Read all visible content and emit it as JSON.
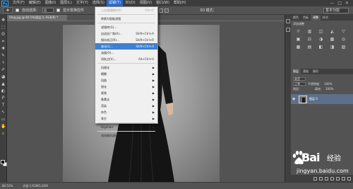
{
  "menubar": {
    "logo": "Ps",
    "items": [
      "文件(F)",
      "编辑(E)",
      "图像(I)",
      "图层(L)",
      "文字(Y)",
      "选择(S)",
      "滤镜(T)",
      "3D(D)",
      "视图(V)",
      "窗口(W)",
      "帮助(H)"
    ],
    "active_index": 6,
    "window_controls": [
      "—",
      "□",
      "✕"
    ]
  },
  "options": {
    "tool_glyph": "✥",
    "auto_select_label": "自动选择：",
    "auto_select_value": "组",
    "show_transform_label": "显示变换控件",
    "mode_3d_label": "3D 模式：",
    "workspace": "基本功能"
  },
  "document_tab": {
    "title": "timg.jpg @ 80.5%(图层 0, RGB/8) *"
  },
  "toolbox": {
    "tools": [
      "✥",
      "⬚",
      "ʘ",
      "⌗",
      "✚",
      "✎",
      "⚕",
      "✐",
      "◕",
      "▲",
      "◐",
      "P",
      "T",
      "↖",
      "▭",
      "✋",
      "⌕"
    ]
  },
  "filter_menu": {
    "groups": [
      [
        {
          "label": "上次滤镜操作(F)",
          "shortcut": "Ctrl+F",
          "disabled": true
        }
      ],
      [
        {
          "label": "转换为智能滤镜"
        }
      ],
      [
        {
          "label": "滤镜库(G)..."
        },
        {
          "label": "自适应广角(A)...",
          "shortcut": "Shift+Ctrl+A"
        },
        {
          "label": "镜头校正(R)...",
          "shortcut": "Shift+Ctrl+R"
        },
        {
          "label": "液化(L)...",
          "shortcut": "Shift+Ctrl+X",
          "highlight": true
        },
        {
          "label": "油画(O)..."
        },
        {
          "label": "消失点(V)...",
          "shortcut": "Alt+Ctrl+V"
        }
      ],
      [
        {
          "label": "风格化",
          "submenu": true
        },
        {
          "label": "模糊",
          "submenu": true
        },
        {
          "label": "扭曲",
          "submenu": true
        },
        {
          "label": "锐化",
          "submenu": true
        },
        {
          "label": "视频",
          "submenu": true
        },
        {
          "label": "像素化",
          "submenu": true
        },
        {
          "label": "渲染",
          "submenu": true
        },
        {
          "label": "杂色",
          "submenu": true
        },
        {
          "label": "其它",
          "submenu": true
        }
      ],
      [
        {
          "label": "Digimarc",
          "submenu": true
        }
      ],
      [
        {
          "label": "浏览联机滤镜..."
        }
      ]
    ]
  },
  "panels": {
    "top_tabs": [
      "颜色",
      "色板",
      "调整",
      "样式"
    ],
    "top_active": 2,
    "adjust_title": "添加调整",
    "adjust_icons": [
      "☼",
      "▥",
      "◫",
      "◭",
      "▽",
      "▣",
      "⚖",
      "◑",
      "▩",
      "◎",
      "▦",
      "▤",
      "◧",
      "◨",
      "▨"
    ],
    "layer_tabs": [
      "图层",
      "通道",
      "路径"
    ],
    "layer_active": 0,
    "kind_label": "类型",
    "blend_mode": "正常",
    "opacity_label": "不透明度：",
    "opacity_value": "100%",
    "lock_label": "锁定：",
    "fill_label": "填充：",
    "fill_value": "100%",
    "layer_name": "图层 0",
    "eye_glyph": "◉",
    "lock_glyph": "🔒"
  },
  "statusbar": {
    "zoom": "80.53%",
    "doc": "文档:1.61M/1.61M"
  },
  "watermark": {
    "brand": "Bai",
    "title": "经验",
    "url": "jingyan.baidu.com"
  }
}
